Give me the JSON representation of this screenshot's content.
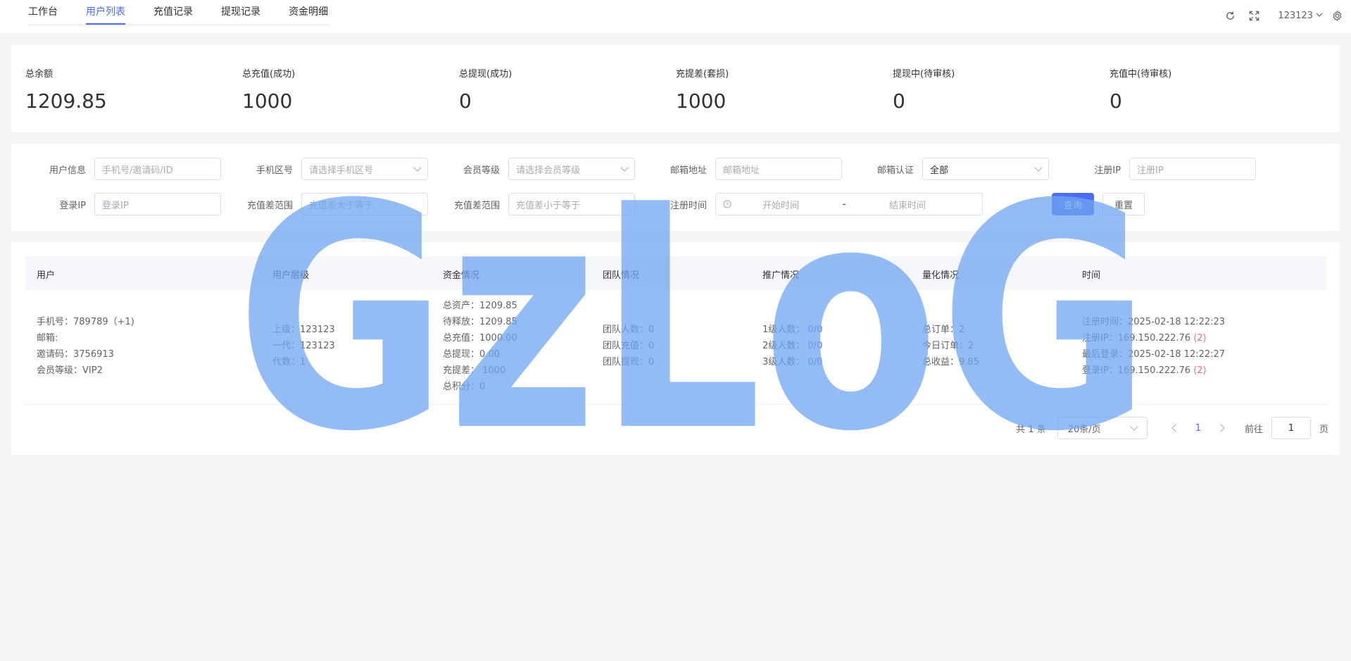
{
  "nav": {
    "tabs": [
      "工作台",
      "用户列表",
      "充值记录",
      "提现记录",
      "资金明细"
    ],
    "active_tab": "用户列表",
    "username": "123123"
  },
  "stats": [
    {
      "label": "总余额",
      "value": "1209.85"
    },
    {
      "label": "总充值(成功)",
      "value": "1000"
    },
    {
      "label": "总提现(成功)",
      "value": "0"
    },
    {
      "label": "充提差(套损)",
      "value": "1000"
    },
    {
      "label": "提现中(待审核)",
      "value": "0"
    },
    {
      "label": "充值中(待审核)",
      "value": "0"
    }
  ],
  "filters": {
    "user_info": {
      "label": "用户信息",
      "placeholder": "手机号/邀请码/ID"
    },
    "phone_area": {
      "label": "手机区号",
      "placeholder": "请选择手机区号"
    },
    "member_level": {
      "label": "会员等级",
      "placeholder": "请选择会员等级"
    },
    "email": {
      "label": "邮箱地址",
      "placeholder": "邮箱地址"
    },
    "email_verified": {
      "label": "邮箱认证",
      "value": "全部"
    },
    "reg_ip": {
      "label": "注册IP",
      "placeholder": "注册IP"
    },
    "login_ip": {
      "label": "登录IP",
      "placeholder": "登录IP"
    },
    "diff_min": {
      "label": "充值差范围",
      "placeholder": "充值差大于等于"
    },
    "diff_max": {
      "label": "充值差范围",
      "placeholder": "充值差小于等于"
    },
    "reg_time": {
      "label": "注册时间",
      "start": "开始时间",
      "sep": "-",
      "end": "结束时间"
    },
    "query_label": "查询",
    "reset_label": "重置"
  },
  "table": {
    "headers": [
      "用户",
      "用户层级",
      "资金情况",
      "团队情况",
      "推广情况",
      "量化情况",
      "时间"
    ],
    "row": {
      "user": [
        "手机号：789789（+1)",
        "邮箱:",
        "邀请码：3756913",
        "会员等级：VIP2"
      ],
      "level": [
        "上级：123123",
        "一代：123123",
        "代数：1"
      ],
      "funds": [
        "总资产：1209.85",
        "待释放：1209.85",
        "总充值：1000.00",
        "总提现：0.00",
        "充提差：  1000",
        "总积分：0"
      ],
      "team": [
        "团队人数：0",
        "团队充值：0",
        "团队提现：0"
      ],
      "promo_labels": [
        "1级人数：",
        "2级人数：",
        "3级人数："
      ],
      "promo_values": [
        "0/0",
        "0/0",
        "0/0"
      ],
      "quant": [
        "总订单：2",
        "今日订单：2",
        "总收益：9.85"
      ],
      "time": {
        "reg_time": "注册时间：2025-02-18 12:22:23",
        "reg_ip": "注册IP：169.150.222.76",
        "reg_ip_count": "(2)",
        "last_login": "最后登录：2025-02-18 12:22:27",
        "login_ip": "登录IP：169.150.222.76",
        "login_ip_count": "(2)"
      }
    }
  },
  "pagination": {
    "total": "共 1 条",
    "page_size": "20条/页",
    "current_page": "1",
    "goto_label": "前往",
    "goto_value": "1",
    "page_suffix": "页"
  },
  "watermark": {
    "text": "GzLoG",
    "color": "#6fa6f0"
  }
}
